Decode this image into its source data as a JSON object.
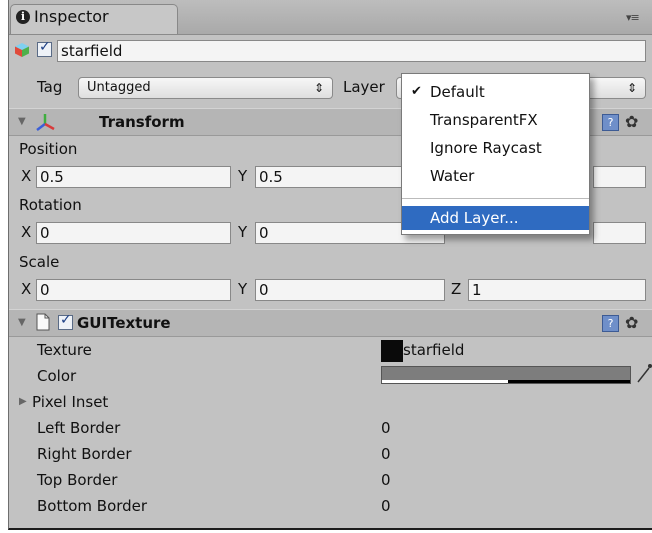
{
  "tab": {
    "icon": "info-icon",
    "label": "Inspector",
    "menu_glyph": "▾≡"
  },
  "object": {
    "name": "starfield",
    "active": true,
    "icon": "gameobject-cube-icon"
  },
  "tag_row": {
    "tag_label": "Tag",
    "tag_value": "Untagged",
    "layer_label": "Layer",
    "popup_arrow": "⇕"
  },
  "transform": {
    "title": "Transform",
    "position": {
      "label": "Position",
      "x_label": "X",
      "x": "0.5",
      "y_label": "Y",
      "y": "0.5"
    },
    "rotation": {
      "label": "Rotation",
      "x_label": "X",
      "x": "0",
      "y_label": "Y",
      "y": "0"
    },
    "scale": {
      "label": "Scale",
      "x_label": "X",
      "x": "0",
      "y_label": "Y",
      "y": "0",
      "z_label": "Z",
      "z": "1"
    }
  },
  "gui_texture": {
    "title": "GUITexture",
    "enabled": true,
    "texture_label": "Texture",
    "texture_value": "starfield",
    "color_label": "Color",
    "pixel_inset_label": "Pixel Inset",
    "left_border_label": "Left Border",
    "left_border": "0",
    "right_border_label": "Right Border",
    "right_border": "0",
    "top_border_label": "Top Border",
    "top_border": "0",
    "bottom_border_label": "Bottom Border",
    "bottom_border": "0"
  },
  "layer_menu": {
    "items": [
      {
        "label": "Default",
        "checked": true
      },
      {
        "label": "TransparentFX",
        "checked": false
      },
      {
        "label": "Ignore Raycast",
        "checked": false
      },
      {
        "label": "Water",
        "checked": false
      }
    ],
    "add_label": "Add Layer...",
    "check_glyph": "✔"
  },
  "colors": {
    "section_bg": "#b5b5b5",
    "panel_bg": "#c2c2c2",
    "menu_highlight": "#2f6bc1"
  }
}
